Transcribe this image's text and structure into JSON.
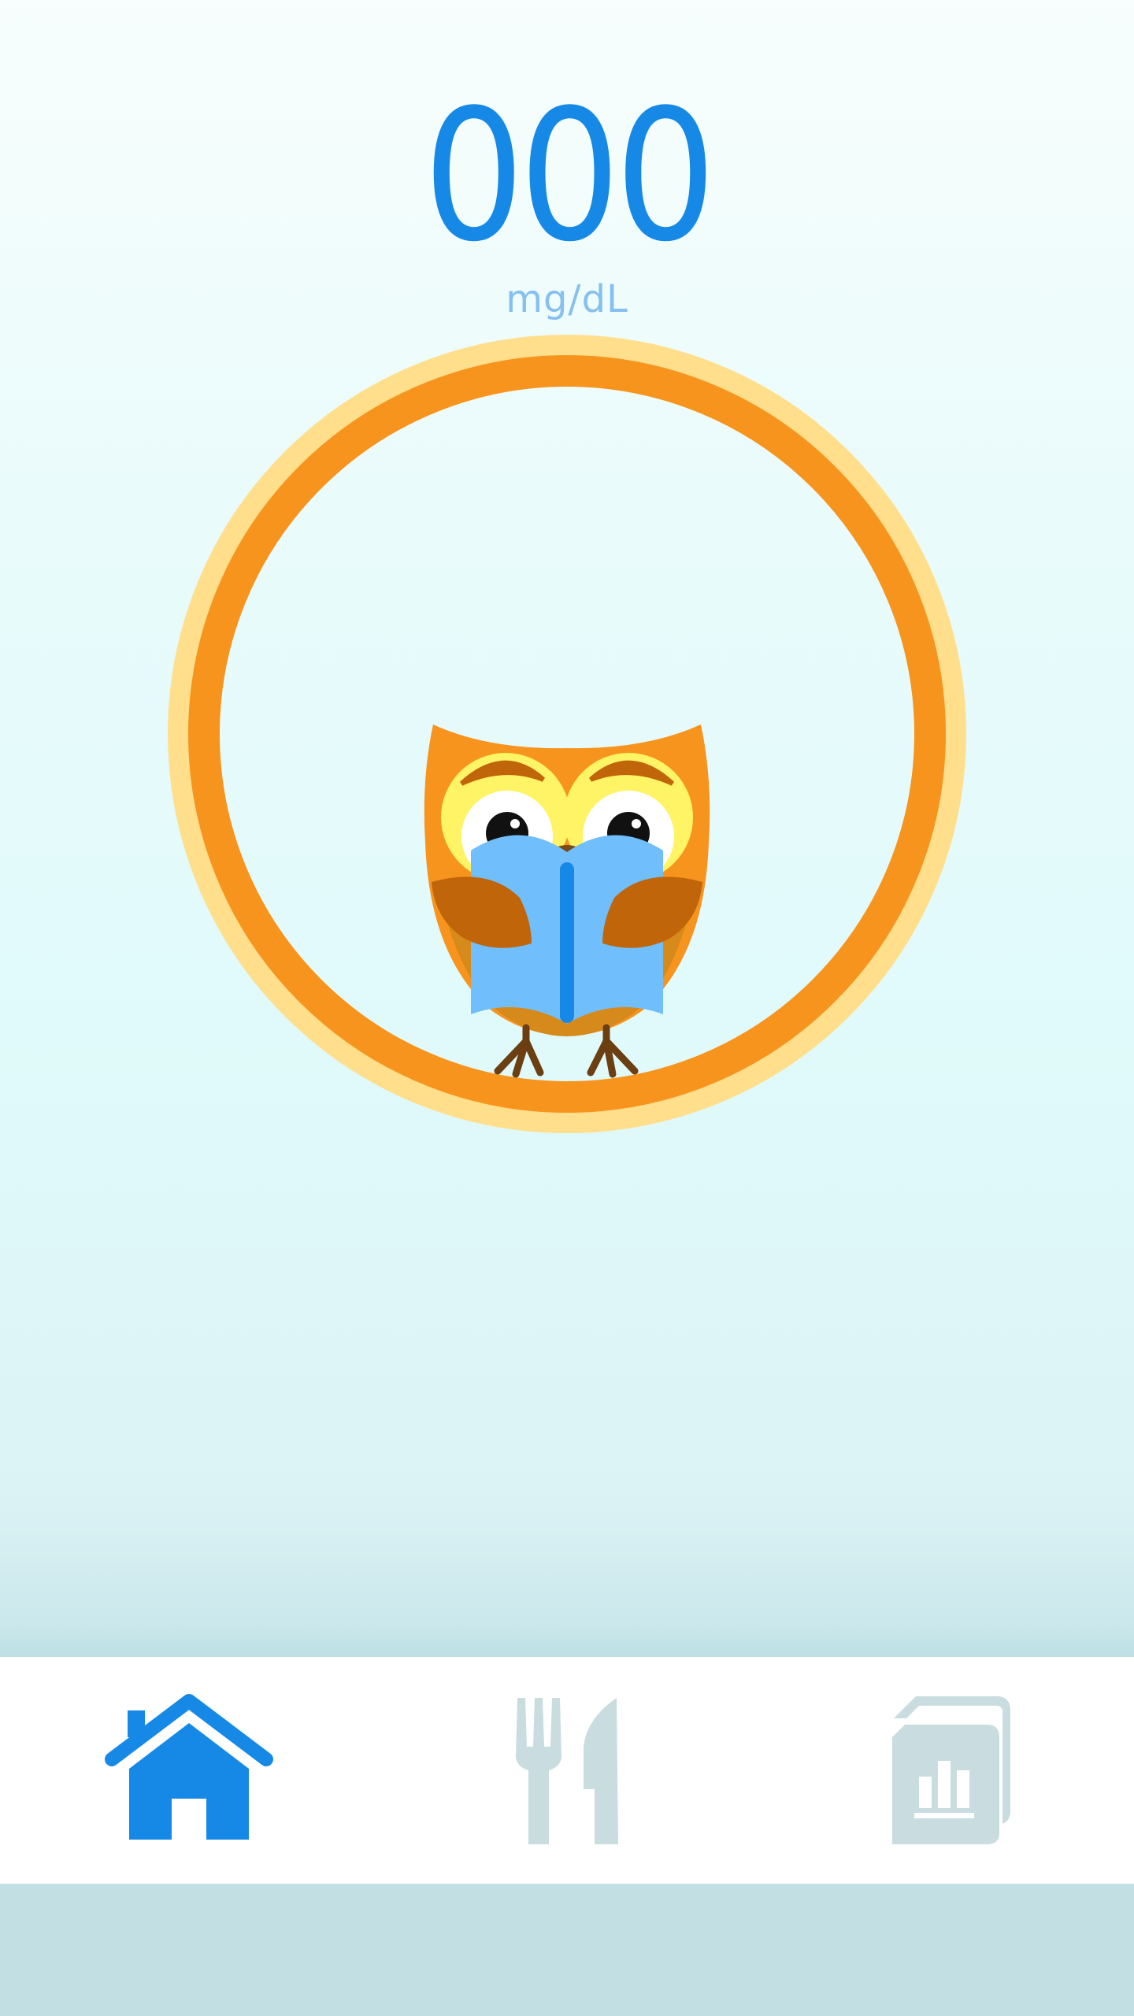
{
  "reading": {
    "value": "000",
    "unit": "mg/dL"
  },
  "colors": {
    "accent_blue": "#1689e6",
    "ring_orange": "#f7941d",
    "ring_halo": "#ffdf8c",
    "nav_inactive": "#c9dce0"
  },
  "mascot": {
    "icon": "owl-reading-book-icon"
  },
  "nav": {
    "items": [
      {
        "icon": "home-icon",
        "active": true
      },
      {
        "icon": "fork-knife-icon",
        "active": false
      },
      {
        "icon": "reports-icon",
        "active": false
      }
    ]
  }
}
